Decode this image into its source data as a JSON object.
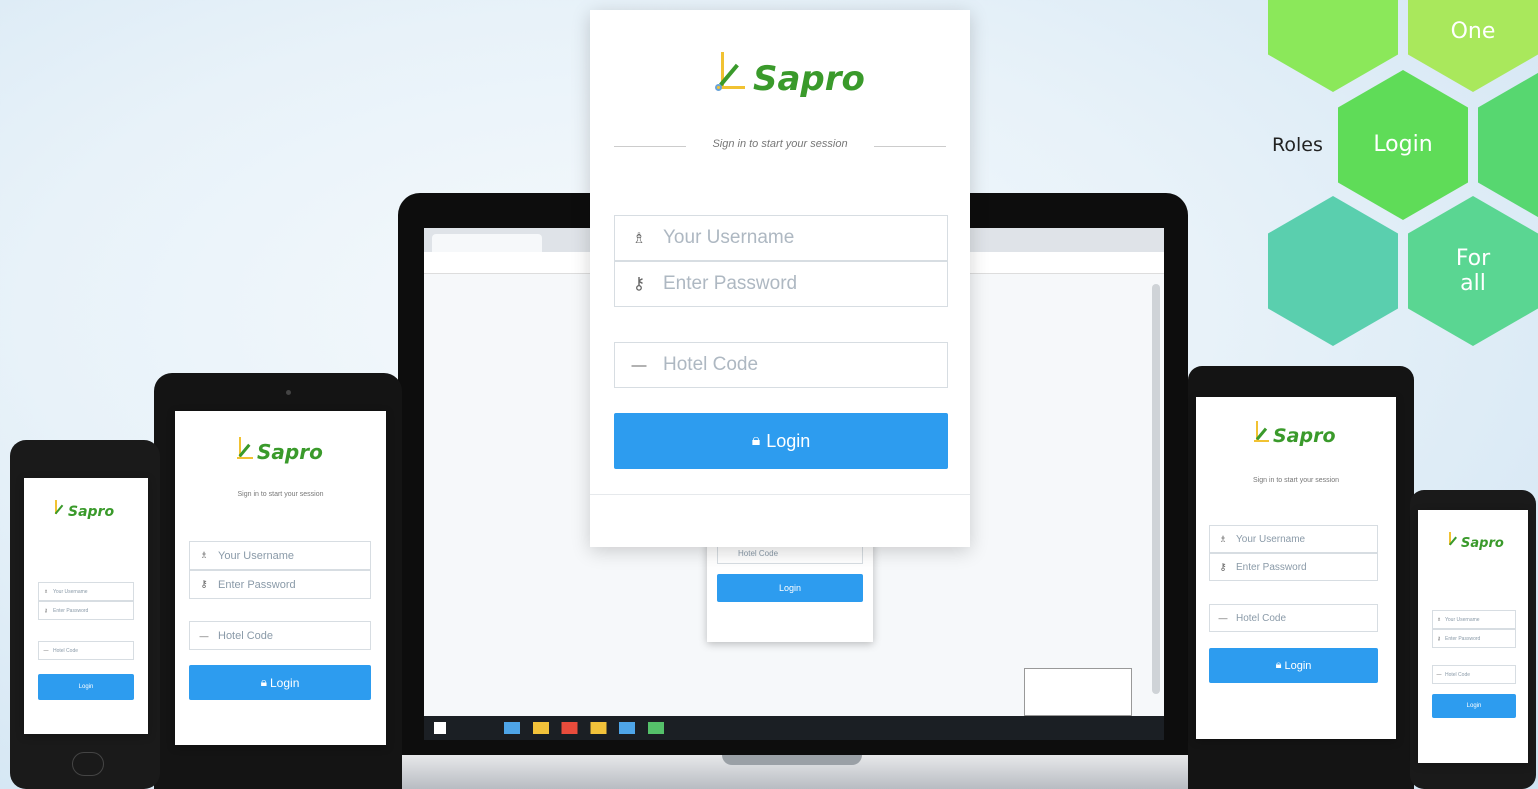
{
  "brand": {
    "name": "Sapro"
  },
  "login_form": {
    "tagline": "Sign in to start your session",
    "username_placeholder": "Your Username",
    "password_placeholder": "Enter Password",
    "hotel_code_placeholder": "Hotel Code",
    "login_label": "Login"
  },
  "hexagons": {
    "one": "One",
    "login": "Login",
    "for_all": "For\nall",
    "roles": "Roles"
  },
  "colors": {
    "accent": "#2d9cef",
    "brand_green": "#3a9a2b",
    "hex_light_green": "#8fe35a",
    "hex_green": "#57d95a",
    "hex_teal": "#5acfae"
  }
}
